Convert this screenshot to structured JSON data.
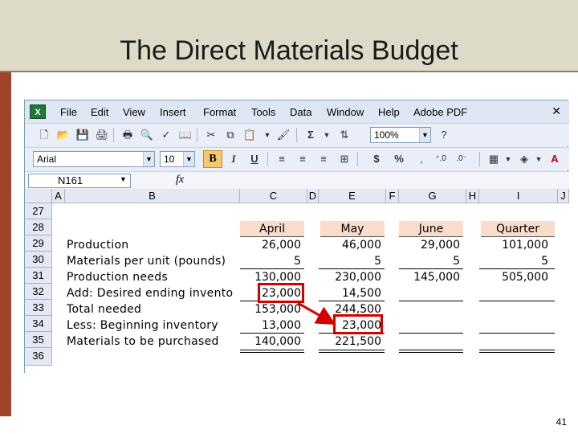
{
  "slide": {
    "title": "The Direct Materials Budget",
    "page_number": "41"
  },
  "menu": {
    "items": [
      "File",
      "Edit",
      "View",
      "Insert",
      "Format",
      "Tools",
      "Data",
      "Window",
      "Help",
      "Adobe PDF"
    ]
  },
  "toolbar": {
    "zoom": "100%",
    "font_name": "Arial",
    "font_size": "10",
    "bold": "B",
    "italic": "I",
    "underline": "U",
    "sigma": "Σ",
    "dollar": "$",
    "percent": "%"
  },
  "formula_bar": {
    "name_box": "N161",
    "fx": "fx"
  },
  "columns": [
    "A",
    "B",
    "C",
    "D",
    "E",
    "F",
    "G",
    "H",
    "I",
    "J"
  ],
  "rows": [
    "27",
    "28",
    "29",
    "30",
    "31",
    "32",
    "33",
    "34",
    "35",
    "36"
  ],
  "table": {
    "headers": [
      "April",
      "May",
      "June",
      "Quarter"
    ],
    "rows": [
      {
        "label": "Production",
        "values": [
          "26,000",
          "46,000",
          "29,000",
          "101,000"
        ]
      },
      {
        "label": "Materials per unit (pounds)",
        "values": [
          "5",
          "5",
          "5",
          "5"
        ]
      },
      {
        "label": "Production needs",
        "values": [
          "130,000",
          "230,000",
          "145,000",
          "505,000"
        ]
      },
      {
        "label": "Add: Desired ending invento",
        "values": [
          "23,000",
          "14,500",
          "",
          ""
        ]
      },
      {
        "label": "Total needed",
        "values": [
          "153,000",
          "244,500",
          "",
          ""
        ]
      },
      {
        "label": "Less: Beginning inventory",
        "values": [
          "13,000",
          "23,000",
          "",
          ""
        ]
      },
      {
        "label": "Materials to be purchased",
        "values": [
          "140,000",
          "221,500",
          "",
          ""
        ]
      }
    ]
  },
  "colors": {
    "header_fill": "#f9dccb",
    "highlight": "#d40000",
    "title_bar": "#dddbc8",
    "stripe": "#a0442c"
  }
}
